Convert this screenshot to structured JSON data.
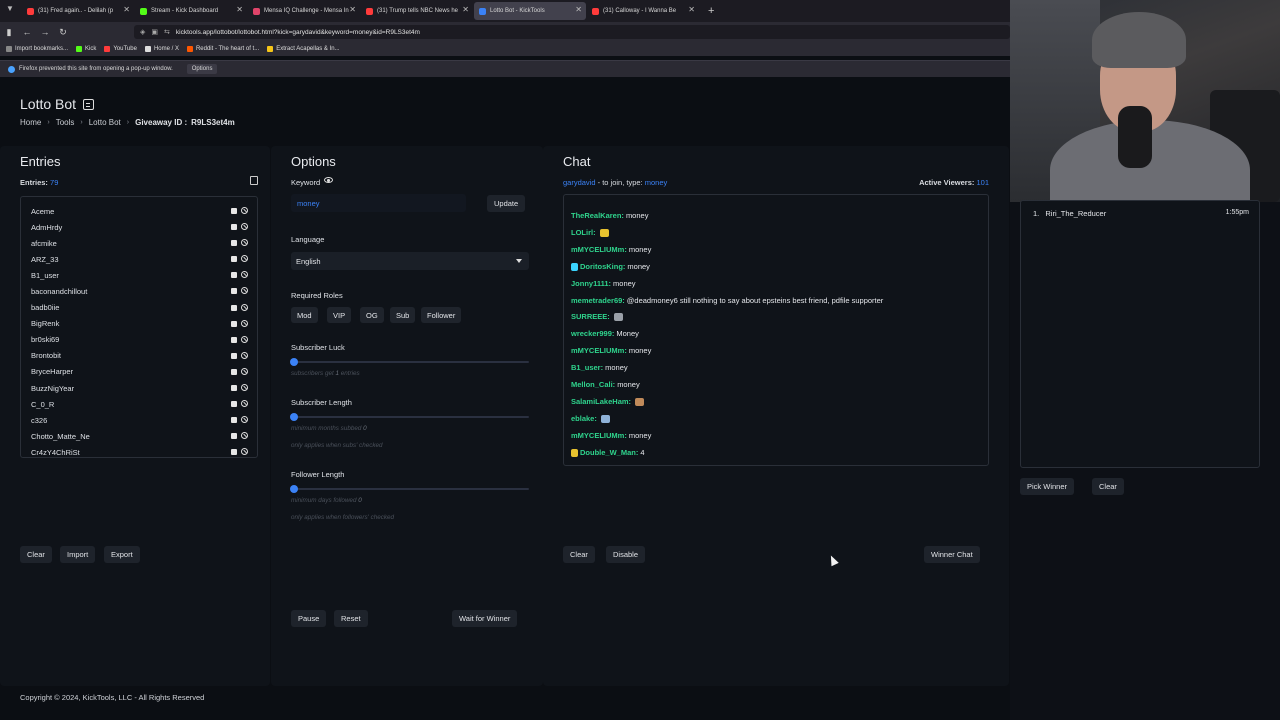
{
  "browser": {
    "tabs": [
      {
        "label": "(31) Fred again.. - Delilah (p",
        "color": "#ff3b3b"
      },
      {
        "label": "Stream - Kick Dashboard",
        "color": "#53fc18"
      },
      {
        "label": "Mensa IQ Challenge - Mensa In",
        "color": "#e0446a"
      },
      {
        "label": "(31) Trump tells NBC News he",
        "color": "#ff3b3b"
      },
      {
        "label": "Lotto Bot - KickTools",
        "color": "#3b82f6"
      },
      {
        "label": "(31) Calloway - I Wanna Be",
        "color": "#ff3b3b"
      }
    ],
    "url": "kicktools.app/lottobot/lottobot.html?kick=garydavid&keyword=money&id=R9LS3et4m",
    "bookmarks": [
      "Import bookmarks...",
      "Kick",
      "YouTube",
      "Home / X",
      "Reddit - The heart of t...",
      "Extract Acapellas & In..."
    ],
    "notice": "Firefox prevented this site from opening a pop-up window.",
    "notice_options": "Options"
  },
  "header": {
    "title": "Lotto Bot",
    "breadcrumb": [
      "Home",
      "Tools",
      "Lotto Bot"
    ],
    "giveaway_label": "Giveaway ID :",
    "giveaway_id": "R9LS3et4m"
  },
  "entries": {
    "title": "Entries",
    "count_label": "Entries:",
    "count": "79",
    "names": [
      "Aceme",
      "AdmHrdy",
      "afcmike",
      "ARZ_33",
      "B1_user",
      "baconandchillout",
      "badb0iie",
      "BigRenk",
      "br0ski69",
      "Brontobit",
      "BryceHarper",
      "BuzzNigYear",
      "C_0_R",
      "c326",
      "Chotto_Matte_Ne",
      "Cr4zY4ChRiSt"
    ],
    "buttons": {
      "clear": "Clear",
      "import": "Import",
      "export": "Export"
    }
  },
  "options": {
    "title": "Options",
    "keyword_label": "Keyword",
    "keyword_value": "money",
    "update": "Update",
    "language_label": "Language",
    "language_value": "English",
    "roles_label": "Required Roles",
    "roles": [
      "Mod",
      "VIP",
      "OG",
      "Sub",
      "Follower"
    ],
    "sub_luck_label": "Subscriber Luck",
    "sub_luck_hint": "subscribers get",
    "sub_luck_value": "1",
    "sub_luck_unit": "entries",
    "sub_luck_level": 0,
    "sub_length_label": "Subscriber Length",
    "sub_length_hint": "minimum months subbed",
    "sub_length_value": "0",
    "sub_length_note": "only applies when subs' checked",
    "sub_length_level": 0,
    "follower_length_label": "Follower Length",
    "follower_length_hint": "minimum days followed",
    "follower_length_value": "0",
    "follower_length_note": "only applies when followers' checked",
    "follower_length_level": 0,
    "pause": "Pause",
    "reset": "Reset",
    "wait": "Wait for Winner"
  },
  "chat": {
    "title": "Chat",
    "channel": "garydavid",
    "join_text": " - to join, type: ",
    "keyword": "money",
    "viewers_label": "Active Viewers:",
    "viewers": "101",
    "messages": [
      {
        "user": "TheRealKaren:",
        "text": "money",
        "color": "#2fd48d"
      },
      {
        "user": "LOLirl:",
        "text": "",
        "color": "#2fd48d",
        "emote": "#e8c22f"
      },
      {
        "user": "mMYCELIUMm:",
        "text": "money",
        "color": "#2fd48d"
      },
      {
        "user": "DoritosKing:",
        "text": "money",
        "color": "#2fd48d",
        "badge": "#3bd4ff"
      },
      {
        "user": "Jonny1111:",
        "text": "money",
        "color": "#2fd48d"
      },
      {
        "user": "memetrader69:",
        "text": "@deadmoney6 still nothing to say about epsteins best friend, pdfile supporter",
        "color": "#2fd48d"
      },
      {
        "user": "SURREEE:",
        "text": "",
        "color": "#2fd48d",
        "emote": "#9aa0a8"
      },
      {
        "user": "wrecker999:",
        "text": "Money",
        "color": "#2fd48d"
      },
      {
        "user": "mMYCELIUMm:",
        "text": "money",
        "color": "#2fd48d"
      },
      {
        "user": "B1_user:",
        "text": "money",
        "color": "#2fd48d"
      },
      {
        "user": "Mellon_Cali:",
        "text": "money",
        "color": "#2fd48d"
      },
      {
        "user": "SalamiLakeHam:",
        "text": "",
        "color": "#2fd48d",
        "emote": "#c08a5a"
      },
      {
        "user": "eblake:",
        "text": "",
        "color": "#2fd48d",
        "emote": "#8fb2d8"
      },
      {
        "user": "mMYCELIUMm:",
        "text": "money",
        "color": "#2fd48d"
      },
      {
        "user": "Double_W_Man:",
        "text": "4",
        "color": "#2fd48d",
        "badge": "#e8c22f"
      }
    ],
    "clear": "Clear",
    "disable": "Disable",
    "winner_chat": "Winner Chat"
  },
  "winners": {
    "list": [
      {
        "rank": "1.",
        "name": "Riri_The_Reducer",
        "time": "1:55pm"
      }
    ],
    "pick": "Pick Winner",
    "clear": "Clear"
  },
  "footer": "Copyright © 2024, KickTools, LLC - All Rights Reserved"
}
